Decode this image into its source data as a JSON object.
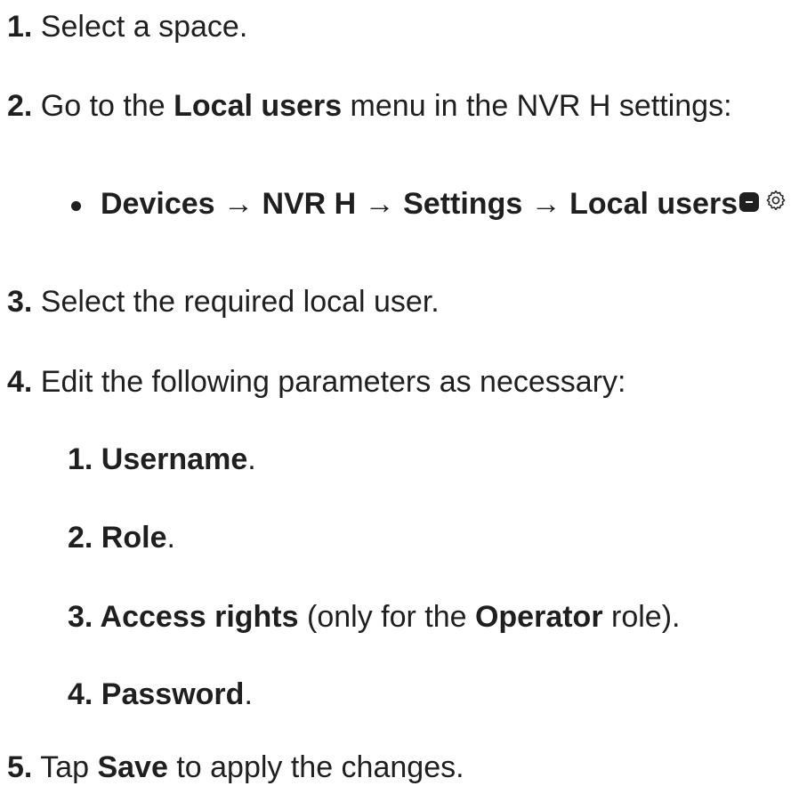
{
  "steps": {
    "s1": {
      "num": "1.",
      "text": " Select a space."
    },
    "s2": {
      "num": "2.",
      "pre": " Go to the ",
      "bold": "Local users",
      "post": " menu in the NVR H settings:"
    },
    "path": {
      "text": "Devices → NVR H → Settings → Local users"
    },
    "s3": {
      "num": "3.",
      "text": " Select the required local user."
    },
    "s4": {
      "num": "4.",
      "text": " Edit the following parameters as necessary:"
    },
    "params": [
      {
        "num": "1.",
        "bold": " Username",
        "post": "."
      },
      {
        "num": "2.",
        "bold": " Role",
        "post": "."
      },
      {
        "num": "3.",
        "bold": " Access rights",
        "mid": " (only for the ",
        "bold2": "Operator",
        "post": " role)."
      },
      {
        "num": "4.",
        "bold": " Password",
        "post": "."
      }
    ],
    "s5": {
      "num": "5.",
      "pre": " Tap ",
      "bold": "Save",
      "post": " to apply the changes."
    }
  },
  "icons": [
    "minus-badge-icon",
    "gear-icon"
  ]
}
